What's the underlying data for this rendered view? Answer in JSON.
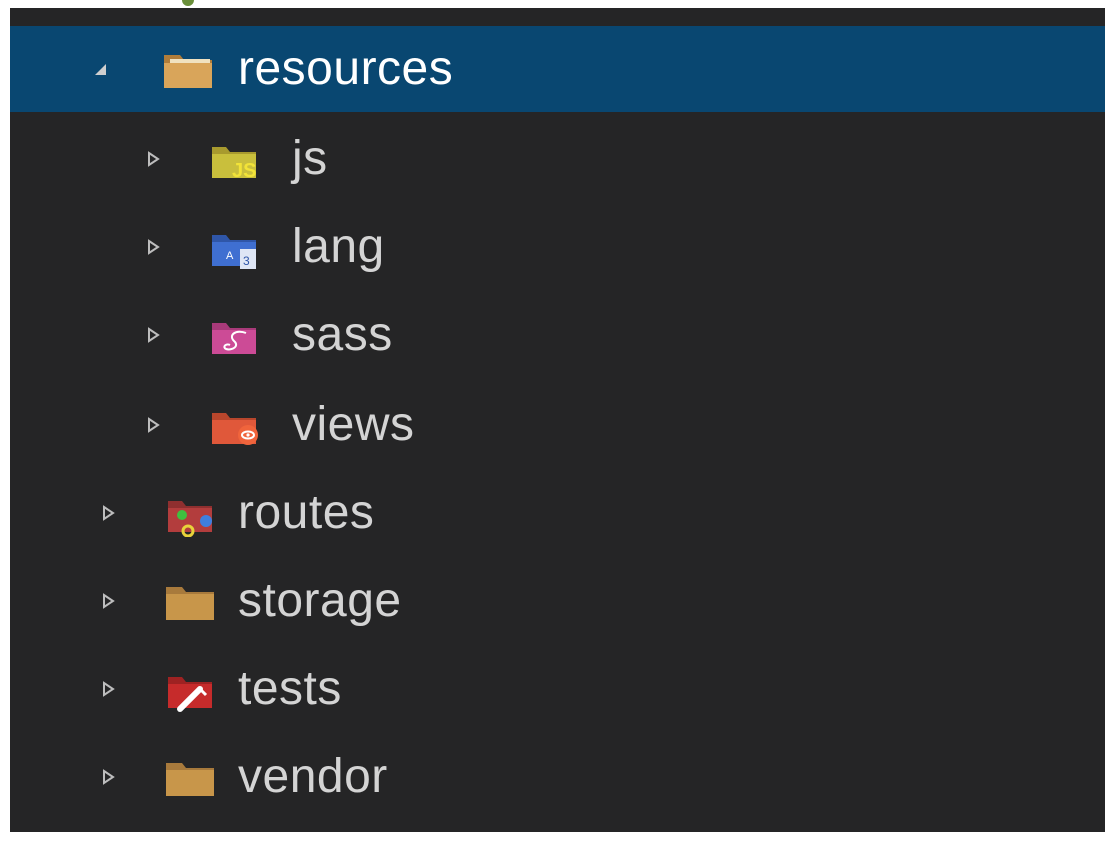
{
  "explorer": {
    "items": [
      {
        "label": "resources",
        "icon": "folder-open-icon",
        "expanded": true,
        "selected": true
      },
      {
        "label": "js",
        "icon": "folder-js-icon",
        "expanded": false
      },
      {
        "label": "lang",
        "icon": "folder-lang-icon",
        "expanded": false
      },
      {
        "label": "sass",
        "icon": "folder-sass-icon",
        "expanded": false
      },
      {
        "label": "views",
        "icon": "folder-views-icon",
        "expanded": false
      },
      {
        "label": "routes",
        "icon": "folder-routes-icon",
        "expanded": false
      },
      {
        "label": "storage",
        "icon": "folder-icon",
        "expanded": false
      },
      {
        "label": "tests",
        "icon": "folder-tests-icon",
        "expanded": false
      },
      {
        "label": "vendor",
        "icon": "folder-icon",
        "expanded": false
      }
    ]
  },
  "colors": {
    "background": "#252526",
    "selection": "#094771",
    "text": "#d4d4d4",
    "folder": "#c8964a",
    "js": "#c9bf3c",
    "lang": "#3f6fd1",
    "sass": "#cc4b96",
    "views": "#e0583a",
    "routes": "#b33d3d",
    "tests": "#c62b2b"
  }
}
